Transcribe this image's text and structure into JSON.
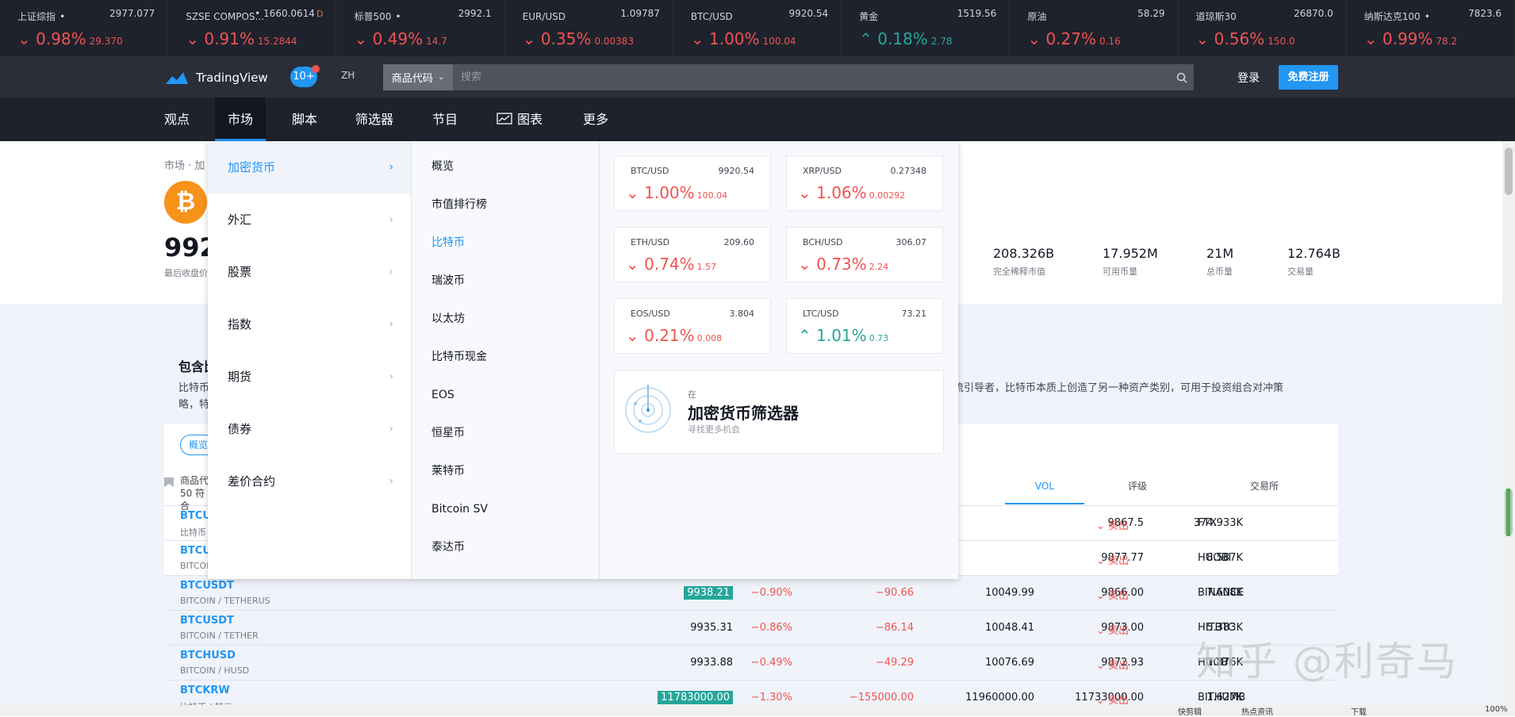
{
  "ticker": [
    {
      "name": "上证综指",
      "dot": "•",
      "price": "2977.077",
      "flag": "",
      "change": "0.98%",
      "delta": "29.370",
      "dir": "down"
    },
    {
      "name": "SZSE COMPOS...",
      "dot": "•",
      "price": "1660.0614",
      "flag": "D",
      "change": "0.91%",
      "delta": "15.2844",
      "dir": "down"
    },
    {
      "name": "标普500",
      "dot": "•",
      "price": "2992.1",
      "flag": "",
      "change": "0.49%",
      "delta": "14.7",
      "dir": "down"
    },
    {
      "name": "EUR/USD",
      "dot": "",
      "price": "1.09787",
      "flag": "",
      "change": "0.35%",
      "delta": "0.00383",
      "dir": "down"
    },
    {
      "name": "BTC/USD",
      "dot": "",
      "price": "9920.54",
      "flag": "",
      "change": "1.00%",
      "delta": "100.04",
      "dir": "down"
    },
    {
      "name": "黄金",
      "dot": "",
      "price": "1519.56",
      "flag": "",
      "change": "0.18%",
      "delta": "2.78",
      "dir": "up"
    },
    {
      "name": "原油",
      "dot": "",
      "price": "58.29",
      "flag": "",
      "change": "0.27%",
      "delta": "0.16",
      "dir": "down"
    },
    {
      "name": "道琼斯30",
      "dot": "",
      "price": "26870.0",
      "flag": "",
      "change": "0.56%",
      "delta": "150.0",
      "dir": "down"
    },
    {
      "name": "纳斯达克100",
      "dot": "•",
      "price": "7823.6",
      "flag": "",
      "change": "0.99%",
      "delta": "78.2",
      "dir": "down"
    }
  ],
  "header": {
    "logo": "TradingView",
    "badge": "10+",
    "lang": "ZH",
    "search_select": "商品代码",
    "search_placeholder": "搜索",
    "login": "登录",
    "register": "免费注册"
  },
  "nav": {
    "ideas": "观点",
    "markets": "市场",
    "scripts": "脚本",
    "screener": "筛选器",
    "shows": "节目",
    "chart": "图表",
    "more": "更多"
  },
  "page": {
    "crumb": "市场 · 加",
    "coin_glyph": "₿",
    "price": "992",
    "price_label": "最后收盘价",
    "stats": [
      {
        "v": "208.326B",
        "l": "完全稀释市值"
      },
      {
        "v": "17.952M",
        "l": "可用币量"
      },
      {
        "v": "21M",
        "l": "总币量"
      },
      {
        "v": "12.764B",
        "l": "交易量"
      }
    ],
    "desc_title": "包含比",
    "desc_p1": "比特币",
    "desc_p2": "略，特",
    "desc_p3": "流引导者，比特币本质上创造了另一种资产类别，可用于投资组合对冲策",
    "tab_pill": "概览",
    "col_symbol": "商品代",
    "col_count": "50 符合",
    "col_vol": "VOL",
    "col_rating": "评级",
    "col_exchange": "交易所",
    "rows": [
      {
        "sym": "BTCUS",
        "sub": "比特币",
        "last": "",
        "chp": "",
        "ch": "",
        "high": "",
        "low": "9867.5",
        "vol": "374.933K",
        "rating": "卖出",
        "ex": "FTX",
        "hl": false
      },
      {
        "sym": "BTCUS",
        "sub": "BITCOI",
        "last": "",
        "chp": "",
        "ch": "",
        "high": "",
        "low": "9877.77",
        "vol": "8.587K",
        "rating": "卖出",
        "ex": "HUOBI",
        "hl": false
      },
      {
        "sym": "BTCUSDT",
        "sub": "BITCOIN / TETHERUS",
        "last": "9938.21",
        "chp": "−0.90%",
        "ch": "−90.66",
        "high": "10049.99",
        "low": "9866.00",
        "vol": "7.608K",
        "rating": "卖出",
        "ex": "BINANCE",
        "hl": true
      },
      {
        "sym": "BTCUSDT",
        "sub": "BITCOIN / TETHER",
        "last": "9935.31",
        "chp": "−0.86%",
        "ch": "−86.14",
        "high": "10048.41",
        "low": "9873.00",
        "vol": "5.383K",
        "rating": "卖出",
        "ex": "HITBTC",
        "hl": false
      },
      {
        "sym": "BTCHUSD",
        "sub": "BITCOIN / HUSD",
        "last": "9933.88",
        "chp": "−0.49%",
        "ch": "−49.29",
        "high": "10076.69",
        "low": "9872.93",
        "vol": "1.876K",
        "rating": "卖出",
        "ex": "HUOBI",
        "hl": false
      },
      {
        "sym": "BTCKRW",
        "sub": "比特币 / 韩元",
        "last": "11783000.00",
        "chp": "−1.30%",
        "ch": "−155000.00",
        "high": "11960000.00",
        "low": "11733000.00",
        "vol": "1.627K",
        "rating": "卖出",
        "ex": "BITHUMB",
        "hl": true
      }
    ]
  },
  "dropdown": {
    "cats": [
      "加密货币",
      "外汇",
      "股票",
      "指数",
      "期货",
      "债券",
      "差价合约"
    ],
    "subs": [
      "概览",
      "市值排行榜",
      "比特币",
      "瑞波币",
      "以太坊",
      "比特币现金",
      "EOS",
      "恒星币",
      "莱特币",
      "Bitcoin SV",
      "泰达币"
    ],
    "cards": [
      {
        "sym": "BTC/USD",
        "price": "9920.54",
        "change": "1.00%",
        "delta": "100.04",
        "dir": "down"
      },
      {
        "sym": "XRP/USD",
        "price": "0.27348",
        "change": "1.06%",
        "delta": "0.00292",
        "dir": "down"
      },
      {
        "sym": "ETH/USD",
        "price": "209.60",
        "change": "0.74%",
        "delta": "1.57",
        "dir": "down"
      },
      {
        "sym": "BCH/USD",
        "price": "306.07",
        "change": "0.73%",
        "delta": "2.24",
        "dir": "down"
      },
      {
        "sym": "EOS/USD",
        "price": "3.804",
        "change": "0.21%",
        "delta": "0.008",
        "dir": "down"
      },
      {
        "sym": "LTC/USD",
        "price": "73.21",
        "change": "1.01%",
        "delta": "0.73",
        "dir": "up"
      }
    ],
    "screener_in": "在",
    "screener_title": "加密货币筛选器",
    "screener_sub": "寻找更多机会"
  },
  "watermark": "知乎 @利奇马",
  "statusbar": [
    "快剪辑",
    "热点资讯",
    "下载",
    "100%"
  ],
  "colors": {
    "down": "#ef5350",
    "up": "#26a69a",
    "accent": "#2196f3",
    "bg_dark": "#1e222d"
  }
}
